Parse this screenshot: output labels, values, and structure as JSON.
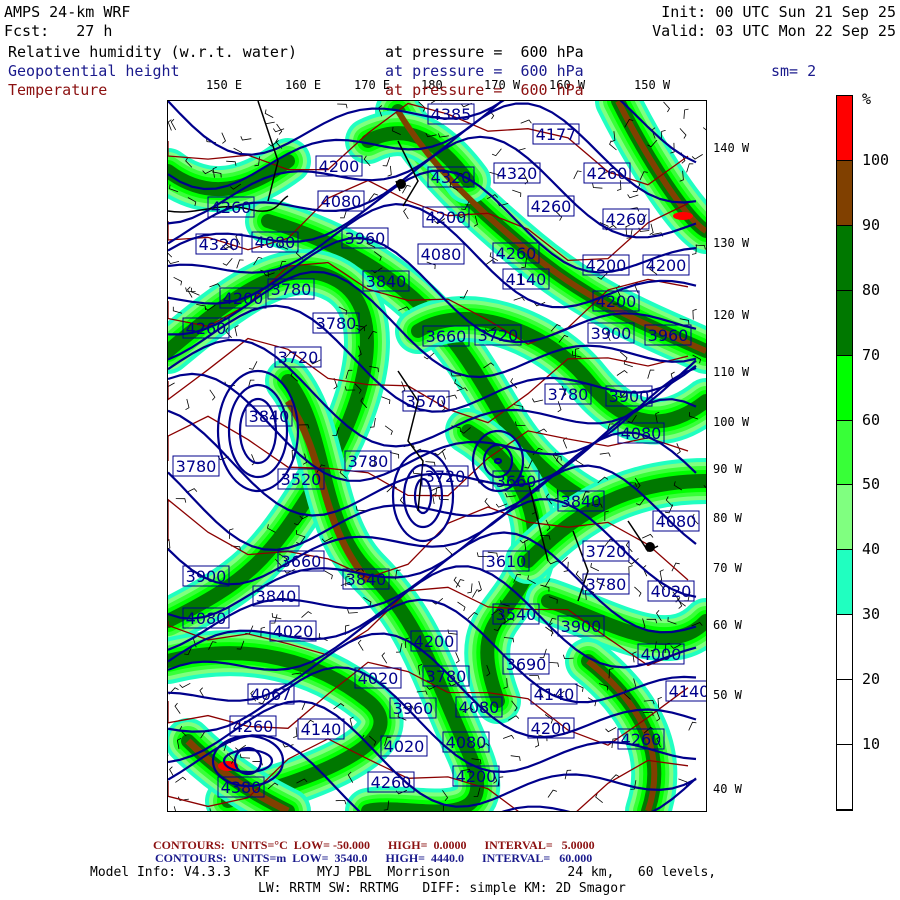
{
  "header": {
    "model": "AMPS 24-km WRF",
    "fcst": "Fcst:   27 h",
    "init": "Init: 00 UTC Sun 21 Sep 25",
    "valid": "Valid: 03 UTC Mon 22 Sep 25",
    "field1": "Relative humidity (w.r.t. water)",
    "field1_level": "at pressure =  600 hPa",
    "field2": "Geopotential height",
    "field2_level": "at pressure =  600 hPa",
    "smoothing": "sm= 2",
    "field3": "Temperature",
    "field3_level": "at pressure =  600 hPa"
  },
  "axes": {
    "top_labels": [
      "150 E",
      "160 E",
      "170 E",
      "180",
      "170 W",
      "160 W",
      "150 W"
    ],
    "right_labels": [
      "140 W",
      "130 W",
      "120 W",
      "110 W",
      "100 W",
      "90 W",
      "80 W",
      "70 W",
      "60 W",
      "50 W",
      "40 W"
    ]
  },
  "map": {
    "height_labels": [
      "4385",
      "4177",
      "4200",
      "4320",
      "4320",
      "4260",
      "4260",
      "4080",
      "4260",
      "4200",
      "4260",
      "4320",
      "4080",
      "3960",
      "4080",
      "4260",
      "4200",
      "4200",
      "3840",
      "4140",
      "4200",
      "3780",
      "4200",
      "3780",
      "4260",
      "3660",
      "3720",
      "3900",
      "3960",
      "3720",
      "3570",
      "3780",
      "3900",
      "3840",
      "4080",
      "3780",
      "3780",
      "3720",
      "3660",
      "3520",
      "3840",
      "4080",
      "3610",
      "3720",
      "3660",
      "3840",
      "3900",
      "3780",
      "4020",
      "3840",
      "3540",
      "4080",
      "4020",
      "3900",
      "4200",
      "4000",
      "3690",
      "3780",
      "4020",
      "4067",
      "4080",
      "4140",
      "4140",
      "3960",
      "4260",
      "4140",
      "4200",
      "4260",
      "4080",
      "4020",
      "4200",
      "4260",
      "4380"
    ],
    "colors": {
      "height": "#00008b",
      "temperature": "#8b0000",
      "coast": "#000000"
    }
  },
  "colorbar": {
    "unit": "%",
    "labels": [
      "100",
      "90",
      "80",
      "70",
      "60",
      "50",
      "40",
      "30",
      "20",
      "10"
    ],
    "colors": [
      "#ff0000",
      "#804000",
      "#007800",
      "#007800",
      "#00ff00",
      "#38ff38",
      "#80ff80",
      "#20ffc0",
      "#ffffff",
      "#ffffff",
      "#ffffff"
    ]
  },
  "footer": {
    "temp_contours": "CONTOURS:  UNITS=°C  LOW= -50.000      HIGH=  0.0000      INTERVAL=   5.0000",
    "height_contours": "CONTOURS:  UNITS=m  LOW=  3540.0      HIGH=  4440.0      INTERVAL=   60.000",
    "model_info": "Model Info: V4.3.3   KF      MYJ PBL  Morrison               24 km,   60 levels,",
    "physics": "LW: RRTM SW: RRTMG   DIFF: simple KM: 2D Smagor"
  }
}
